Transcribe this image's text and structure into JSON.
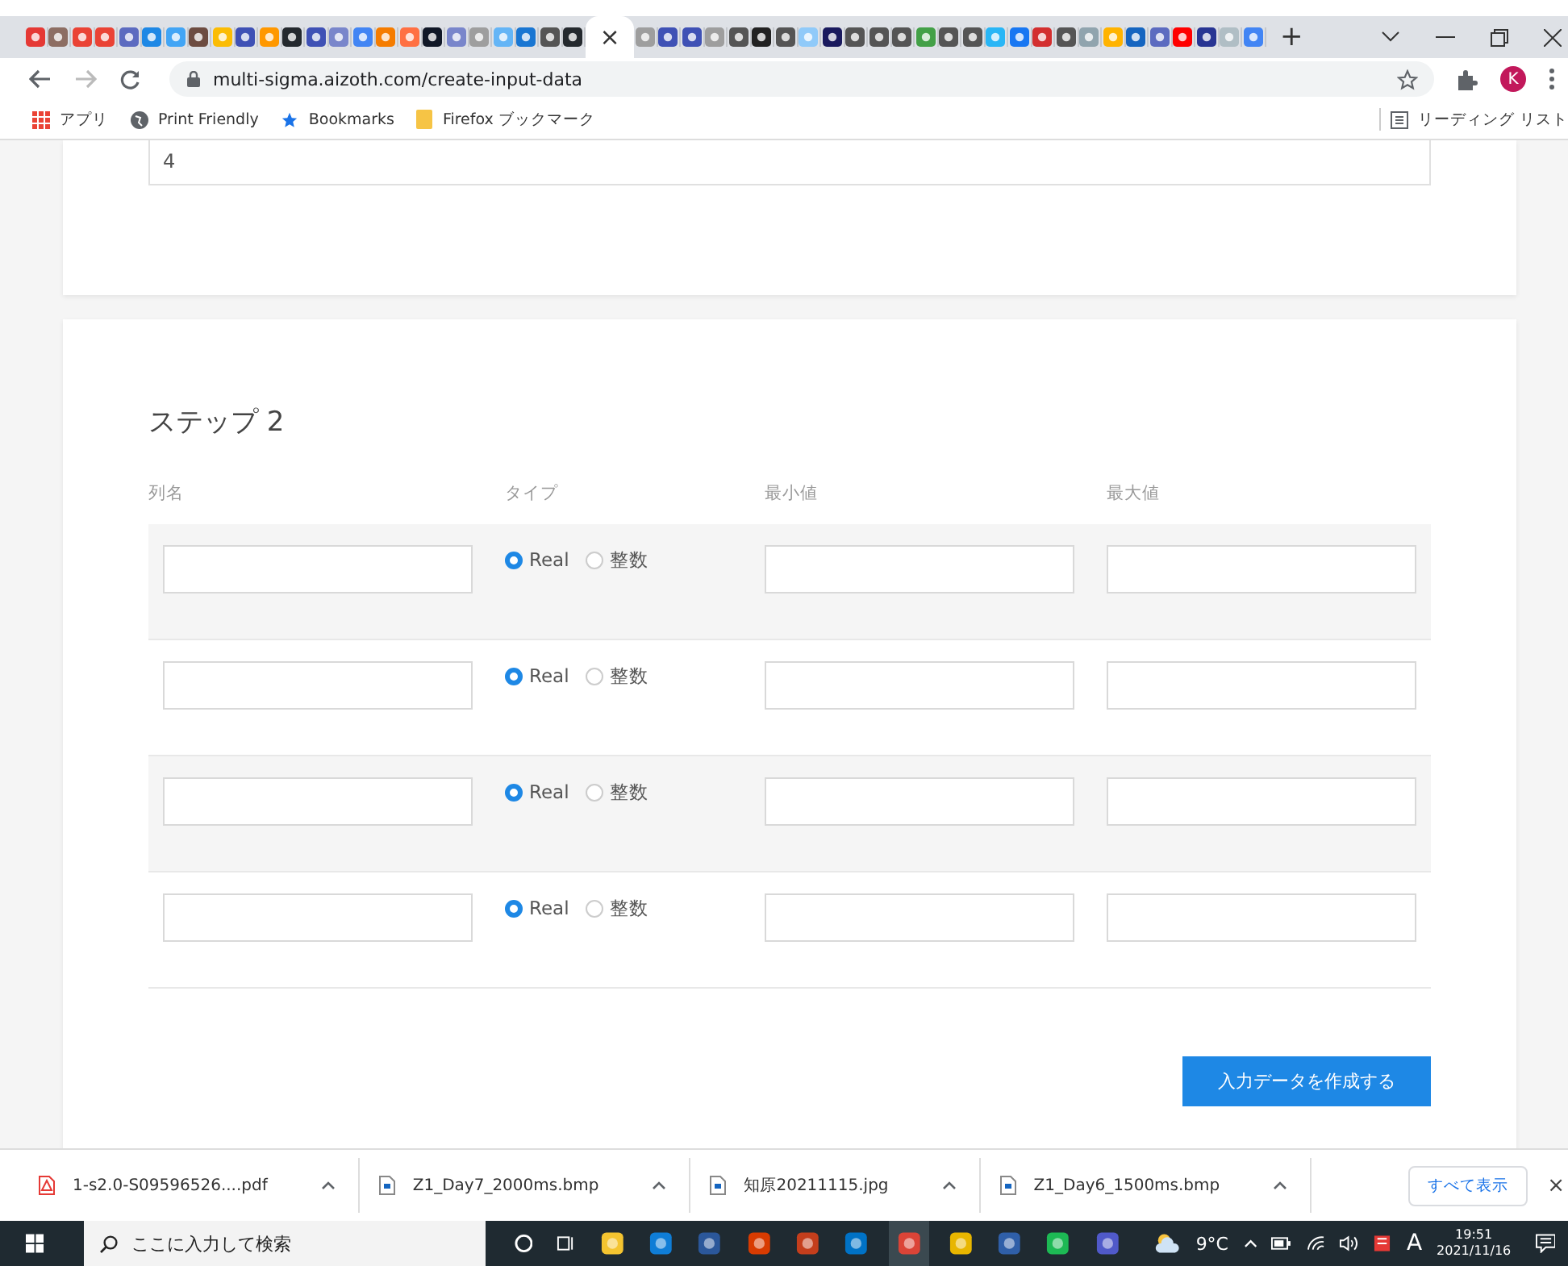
{
  "browser": {
    "tab_close": "×",
    "new_tab": "+",
    "url": "multi-sigma.aizoth.com/create-input-data",
    "profile": "K",
    "bookmarks": [
      {
        "label": "アプリ",
        "kind": "apps"
      },
      {
        "label": "Print Friendly",
        "kind": "globe"
      },
      {
        "label": "Bookmarks",
        "kind": "star"
      },
      {
        "label": "Firefox ブックマーク",
        "kind": "folder"
      }
    ],
    "reading_list": "リーディング リスト"
  },
  "page": {
    "previous_value": "4",
    "step_title": "ステップ 2",
    "columns": [
      "列名",
      "タイプ",
      "最小値",
      "最大値"
    ],
    "rows": [
      {
        "options": [
          {
            "label": "Real",
            "selected": true
          },
          {
            "label": "整数",
            "selected": false
          }
        ]
      },
      {
        "options": [
          {
            "label": "Real",
            "selected": true
          },
          {
            "label": "整数",
            "selected": false
          }
        ]
      },
      {
        "options": [
          {
            "label": "Real",
            "selected": true
          },
          {
            "label": "整数",
            "selected": false
          }
        ]
      },
      {
        "options": [
          {
            "label": "Real",
            "selected": true
          },
          {
            "label": "整数",
            "selected": false
          }
        ]
      }
    ],
    "submit": "入力データを作成する"
  },
  "downloads": {
    "items": [
      {
        "name": "1-s2.0-S09596526....pdf",
        "kind": "pdf"
      },
      {
        "name": "Z1_Day7_2000ms.bmp",
        "kind": "image"
      },
      {
        "name": "知原20211115.jpg",
        "kind": "image"
      },
      {
        "name": "Z1_Day6_1500ms.bmp",
        "kind": "image"
      }
    ],
    "show_all": "すべて表示",
    "close": "×"
  },
  "taskbar": {
    "search_placeholder": "ここに入力して検索",
    "weather": "9°C",
    "ime": "A",
    "time": "19:51",
    "date": "2021/11/16"
  }
}
